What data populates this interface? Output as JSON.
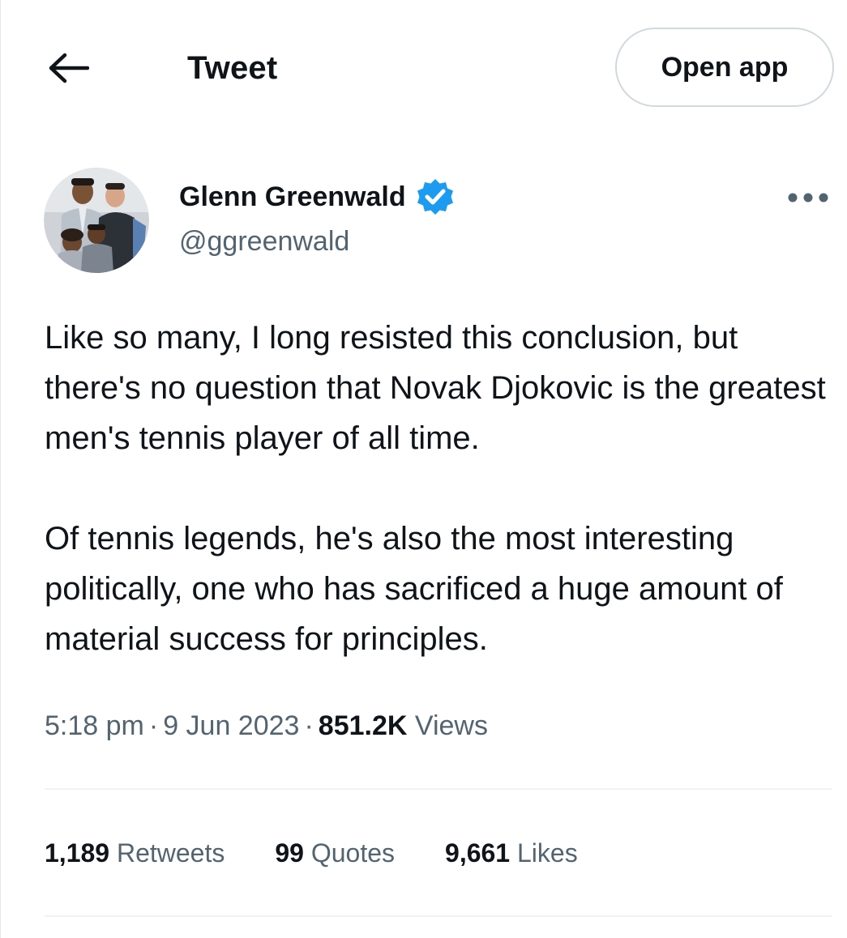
{
  "header": {
    "back_icon": "arrow-left-icon",
    "title": "Tweet",
    "open_app_label": "Open app"
  },
  "author": {
    "name": "Glenn Greenwald",
    "handle": "@ggreenwald",
    "verified_icon": "verified-badge-icon",
    "verified_color": "#1d9bf0",
    "more_icon": "more-dots-icon"
  },
  "tweet": {
    "paragraphs": [
      "Like so many, I long resisted this conclusion, but there's no question that Novak Djokovic is the greatest men's tennis player of all time.",
      "Of tennis legends, he's also the most interesting politically, one who has sacrificed a huge amount of material success for principles."
    ],
    "time": "5:18 pm",
    "date": "9 Jun 2023",
    "separator": "·",
    "views_count": "851.2K",
    "views_label": "Views"
  },
  "stats": {
    "retweets_count": "1,189",
    "retweets_label": "Retweets",
    "quotes_count": "99",
    "quotes_label": "Quotes",
    "likes_count": "9,661",
    "likes_label": "Likes"
  },
  "colors": {
    "text_primary": "#0f1419",
    "text_secondary": "#536471",
    "border": "#cfd9de",
    "divider": "#eff3f4"
  }
}
